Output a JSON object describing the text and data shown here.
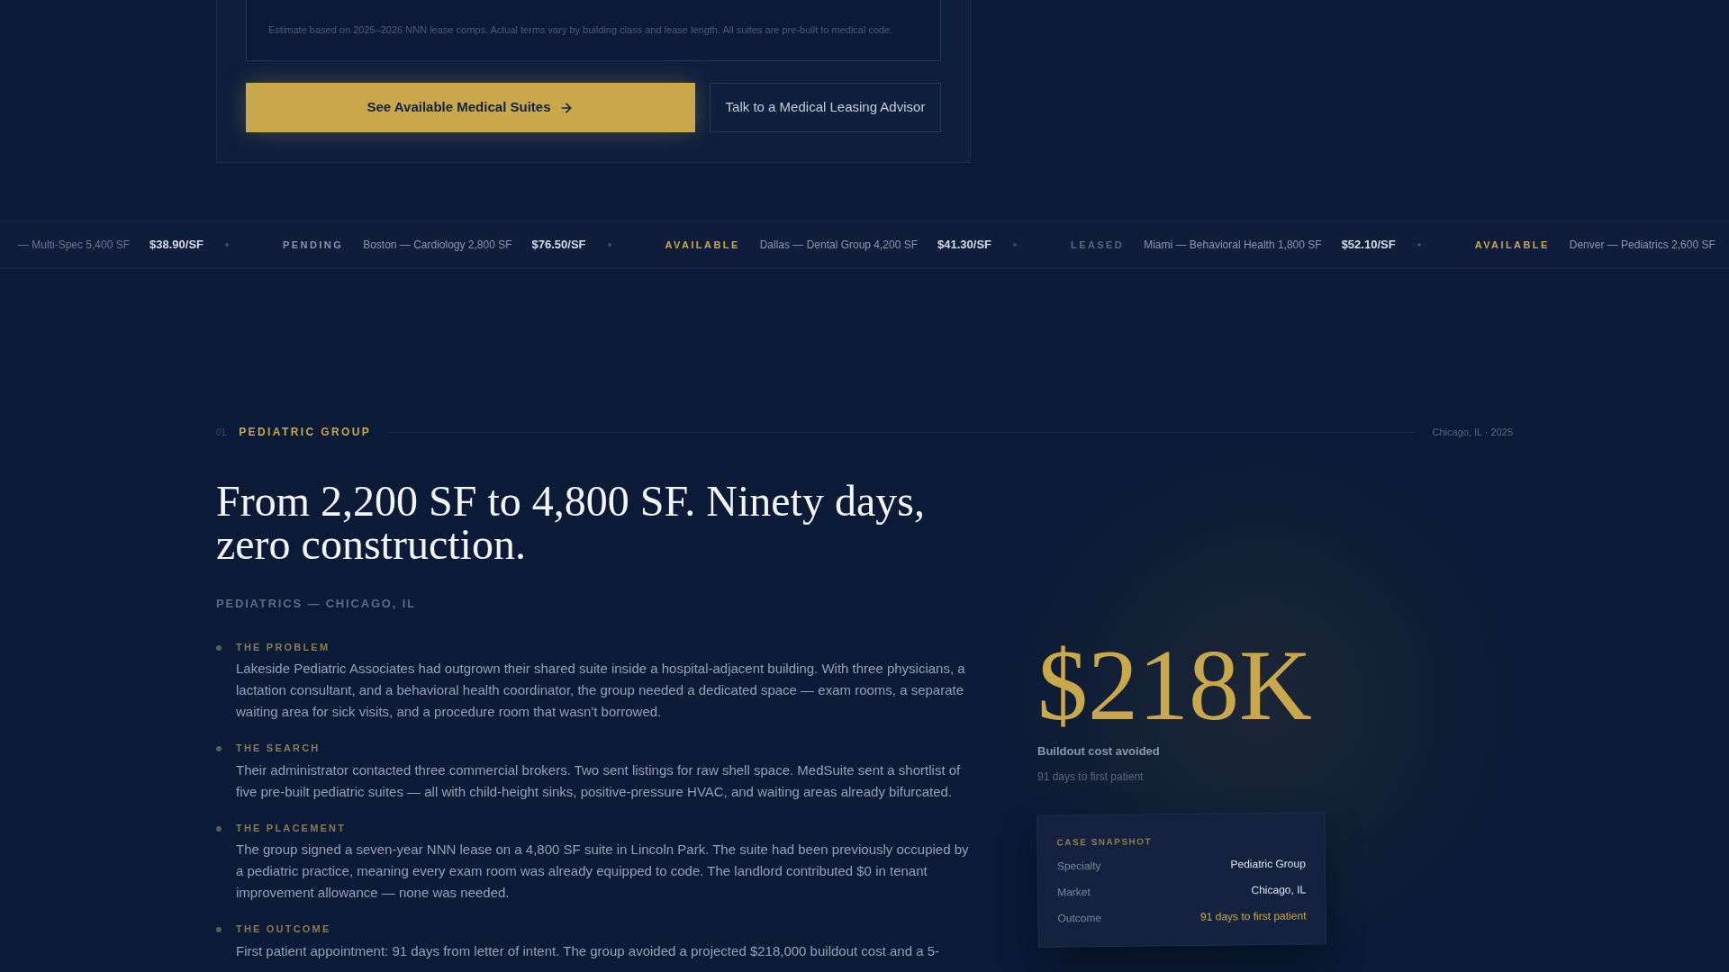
{
  "estimate": {
    "note": "Estimate based on 2025–2026 NNN lease comps. Actual terms vary by building class and lease length. All suites are pre-built to medical code.",
    "buttons": [
      {
        "kind": "primary",
        "label": "See Available Medical Suites"
      },
      {
        "kind": "secondary",
        "label": "Talk to a Medical Leasing Advisor"
      }
    ]
  },
  "ticker": [
    {
      "kind": "none",
      "listing": "— Multi-Spec 5,400 SF",
      "price": "$38.90/SF"
    },
    {
      "kind": "pending",
      "status": "PENDING",
      "listing": "Boston — Cardiology 2,800 SF",
      "price": "$76.50/SF"
    },
    {
      "kind": "available",
      "status": "AVAILABLE",
      "listing": "Dallas — Dental Group 4,200 SF",
      "price": "$41.30/SF"
    },
    {
      "kind": "leased",
      "status": "LEASED",
      "listing": "Miami — Behavioral Health 1,800 SF",
      "price": "$52.10/SF"
    },
    {
      "kind": "available",
      "status": "AVAILABLE",
      "listing": "Denver — Pediatrics 2,600 SF"
    }
  ],
  "case": {
    "number": "01",
    "label": "PEDIATRIC GROUP",
    "location_year": "Chicago, IL · 2025",
    "headline": "From 2,200 SF to 4,800 SF. Ninety days, zero construction.",
    "subtitle": "PEDIATRICS — CHICAGO, IL",
    "steps": [
      {
        "title": "THE PROBLEM",
        "text": "Lakeside Pediatric Associates had outgrown their shared suite inside a hospital-adjacent building. With three physicians, a lactation consultant, and a behavioral health coordinator, the group needed a dedicated space — exam rooms, a separate waiting area for sick visits, and a procedure room that wasn't borrowed."
      },
      {
        "title": "THE SEARCH",
        "text": "Their administrator contacted three commercial brokers. Two sent listings for raw shell space. MedSuite sent a shortlist of five pre-built pediatric suites — all with child-height sinks, positive-pressure HVAC, and waiting areas already bifurcated."
      },
      {
        "title": "THE PLACEMENT",
        "text": "The group signed a seven-year NNN lease on a 4,800 SF suite in Lincoln Park. The suite had been previously occupied by a pediatric practice, meaning every exam room was already equipped to code. The landlord contributed $0 in tenant improvement allowance — none was needed."
      },
      {
        "title": "THE OUTCOME",
        "text": "First patient appointment: 91 days from letter of intent. The group avoided a projected $218,000 buildout cost and a 5-"
      }
    ],
    "stat": {
      "value": "$218K",
      "label": "Buildout cost avoided",
      "sub": "91 days to first patient"
    },
    "snapshot": {
      "title": "CASE SNAPSHOT",
      "rows": [
        {
          "key": "Specialty",
          "value": "Pediatric Group",
          "highlight": false
        },
        {
          "key": "Market",
          "value": "Chicago, IL",
          "highlight": false
        },
        {
          "key": "Outcome",
          "value": "91 days to first patient",
          "highlight": true
        }
      ]
    }
  }
}
